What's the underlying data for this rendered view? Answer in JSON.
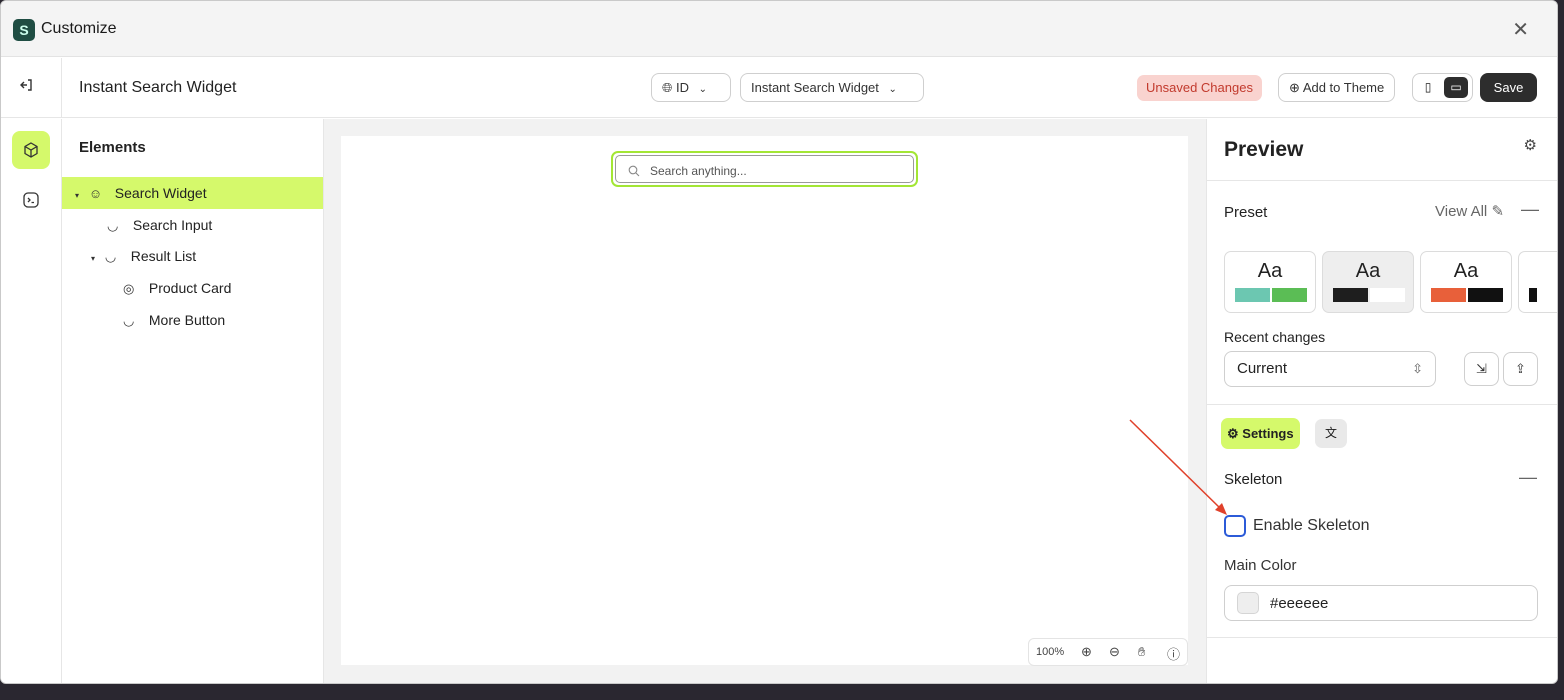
{
  "titlebar": {
    "app_title": "Customize",
    "logo_glyph": "S",
    "close_glyph": "✕"
  },
  "toolbar": {
    "widget_title": "Instant Search Widget",
    "language_label": "ID",
    "template_label": "Instant Search Widget",
    "unsaved_label": "Unsaved Changes",
    "add_to_theme_label": "Add to Theme",
    "save_label": "Save"
  },
  "elements_panel": {
    "heading": "Elements",
    "items": [
      {
        "label": "Search Widget",
        "icon": "widget-icon",
        "active": true
      },
      {
        "label": "Search Input",
        "icon": "block-icon"
      },
      {
        "label": "Result List",
        "icon": "block-icon"
      },
      {
        "label": "Product Card",
        "icon": "product-icon"
      },
      {
        "label": "More Button",
        "icon": "block-icon"
      }
    ]
  },
  "canvas": {
    "search_placeholder": "Search anything...",
    "zoom_level": "100%"
  },
  "preview_panel": {
    "title": "Preview",
    "preset_label": "Preset",
    "view_all_label": "View All",
    "preset_swatch_text": "Aa",
    "presets": [
      {
        "colors": [
          "#6cc7b1",
          "#5bbd55"
        ]
      },
      {
        "colors": [
          "#1e1e1e",
          "#ffffff"
        ],
        "selected": true
      },
      {
        "colors": [
          "#e8603a",
          "#111111"
        ]
      },
      {
        "colors": [
          "#111111"
        ]
      }
    ],
    "recent_changes_label": "Recent changes",
    "recent_changes_value": "Current",
    "settings_tab_label": "Settings",
    "skeleton_section_label": "Skeleton",
    "enable_skeleton_label": "Enable Skeleton",
    "enable_skeleton_checked": false,
    "main_color_label": "Main Color",
    "main_color_value": "#eeeeee"
  },
  "colors": {
    "accent": "#d5f96b",
    "save_bg": "#2d2d2d",
    "unsaved_bg": "#f9d3cf",
    "unsaved_text": "#c23a2d",
    "widget_outline": "#a3e635",
    "annotation_arrow": "#e0412b",
    "checkbox_focus": "#2c5bd8"
  }
}
